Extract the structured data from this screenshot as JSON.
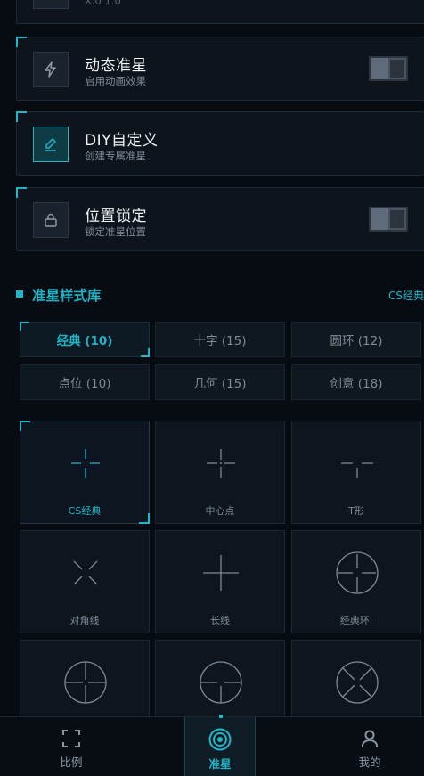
{
  "top_stub": {
    "text": "X.0 1.0"
  },
  "cards": [
    {
      "title": "动态准星",
      "sub": "启用动画效果",
      "icon": "lightning-icon",
      "has_toggle": true
    },
    {
      "title": "DIY自定义",
      "sub": "创建专属准星",
      "icon": "pencil-icon",
      "has_toggle": false
    },
    {
      "title": "位置锁定",
      "sub": "锁定准星位置",
      "icon": "lock-icon",
      "has_toggle": true
    }
  ],
  "section": {
    "title": "准星样式库",
    "right": "CS经典"
  },
  "tabs": [
    "经典 (10)",
    "十字 (15)",
    "圆环 (12)",
    "点位 (10)",
    "几何 (15)",
    "创意 (18)"
  ],
  "tiles": [
    {
      "label": "CS经典",
      "icon": "cs-classic-crosshair-icon"
    },
    {
      "label": "中心点",
      "icon": "center-dot-crosshair-icon"
    },
    {
      "label": "T形",
      "icon": "t-shape-crosshair-icon"
    },
    {
      "label": "对角线",
      "icon": "diagonal-crosshair-icon"
    },
    {
      "label": "长线",
      "icon": "long-line-crosshair-icon"
    },
    {
      "label": "经典环I",
      "icon": "classic-ring-crosshair-icon"
    },
    {
      "label": "",
      "icon": "ring-cross-crosshair-icon"
    },
    {
      "label": "",
      "icon": "ring-t-crosshair-icon"
    },
    {
      "label": "",
      "icon": "ring-x-crosshair-icon"
    }
  ],
  "nav": [
    {
      "label": "比例",
      "icon": "aspect-ratio-icon"
    },
    {
      "label": "准星",
      "icon": "target-icon"
    },
    {
      "label": "我的",
      "icon": "user-icon"
    }
  ],
  "colors": {
    "accent": "#1fb6c9",
    "background": "#070c12",
    "card": "#0d141c"
  }
}
